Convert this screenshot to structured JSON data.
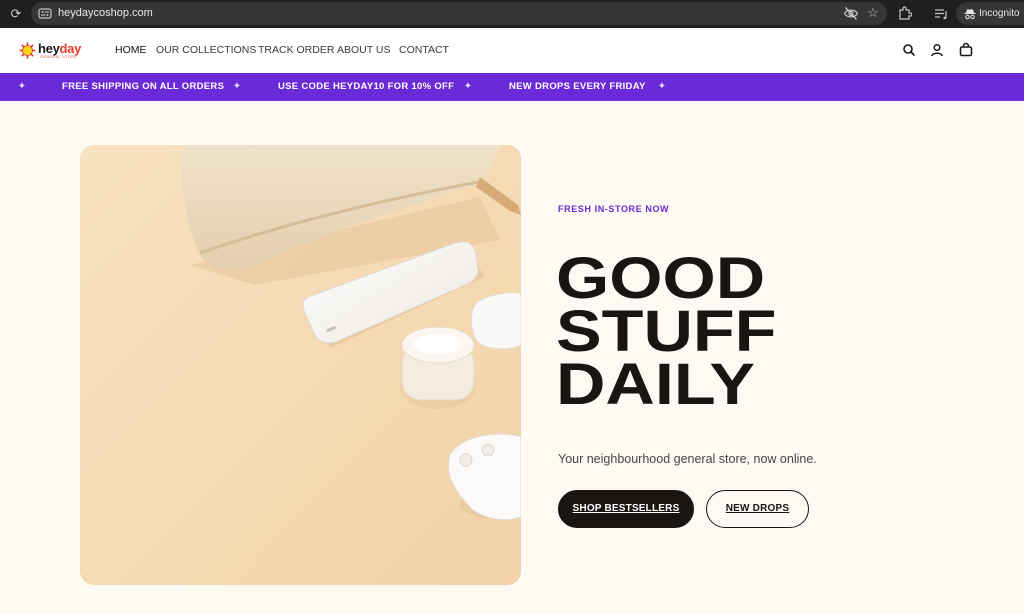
{
  "browser": {
    "url": "heydaycoshop.com",
    "profile_label": "Incognito",
    "icons": [
      "reload-icon",
      "site-settings-icon",
      "eye-off-icon",
      "star-icon",
      "extensions-icon",
      "media-controls-icon",
      "incognito-icon"
    ]
  },
  "header": {
    "logo": {
      "word_main": "hey",
      "word_accent": "day",
      "tagline": "GENERAL STORE"
    },
    "nav": [
      "HOME",
      "OUR COLLECTIONS",
      "TRACK ORDER",
      "ABOUT US",
      "CONTACT"
    ],
    "active_nav": "HOME",
    "icons": [
      "search-icon",
      "account-icon",
      "cart-icon"
    ]
  },
  "announcement": {
    "messages": [
      "FREE SHIPPING ON ALL ORDERS",
      "USE CODE HEYDAY10 FOR 10% OFF",
      "NEW DROPS EVERY FRIDAY"
    ],
    "separator": "✦"
  },
  "hero": {
    "eyebrow": "FRESH IN-STORE NOW",
    "headline": [
      "GOOD",
      "STUFF",
      "DAILY"
    ],
    "subtitle": "Your neighbourhood general store, now online.",
    "primary_cta": "SHOP BESTSELLERS",
    "secondary_cta": "NEW DROPS"
  },
  "colors": {
    "accent": "#6a2ad8",
    "dark": "#1a1512",
    "page_bg": "#fdf9f3",
    "logo_red": "#e63b2e",
    "logo_yellow": "#f3d21c"
  }
}
